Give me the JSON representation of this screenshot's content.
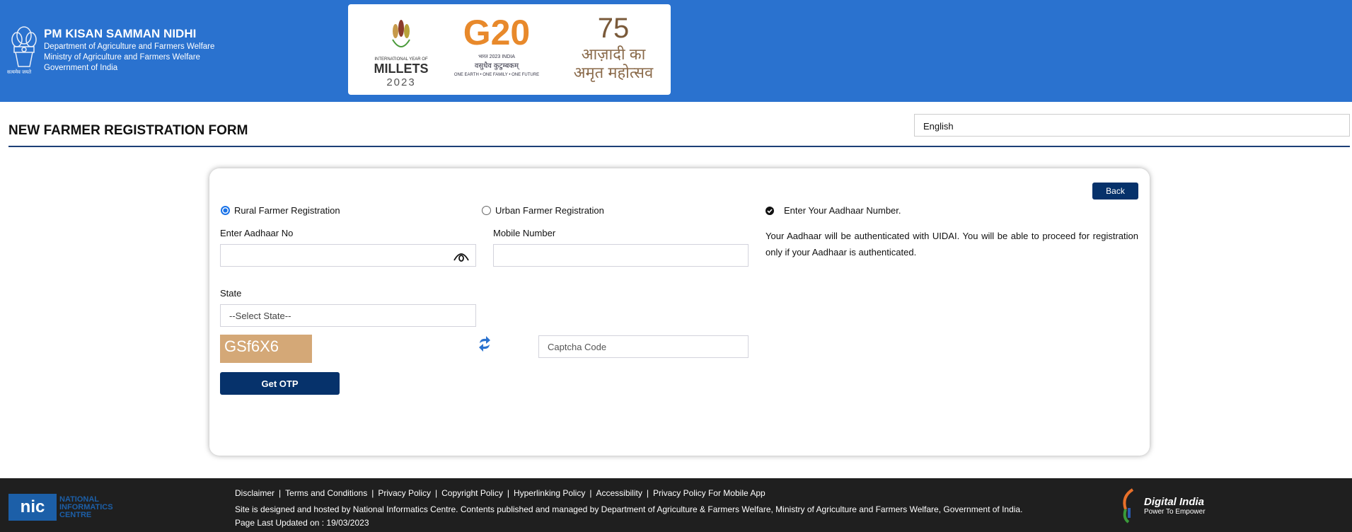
{
  "header": {
    "title": "PM KISAN SAMMAN NIDHI",
    "lines": [
      "Department of Agriculture and Farmers Welfare",
      "Ministry of Agriculture and Farmers Welfare",
      "Government of India"
    ],
    "emblem_caption": "सत्यमेव जयते",
    "logos": {
      "millets": {
        "top": "INTERNATIONAL YEAR OF",
        "name": "MILLETS",
        "year": "2023"
      },
      "g20": {
        "name": "G20",
        "sub": "भारत 2023 INDIA",
        "hindi": "वसुधैव कुटुम्बकम्",
        "tagline": "ONE EARTH • ONE FAMILY • ONE FUTURE"
      },
      "azadi": {
        "num": "75",
        "line1": "आज़ादी का",
        "line2": "अमृत महोत्सव"
      }
    }
  },
  "page": {
    "title": "NEW FARMER REGISTRATION FORM",
    "language": "English"
  },
  "form": {
    "back": "Back",
    "rural": "Rural Farmer Registration",
    "urban": "Urban Farmer Registration",
    "selected": "rural",
    "aadhaar_label": "Enter Aadhaar No",
    "aadhaar_value": "",
    "mobile_label": "Mobile Number",
    "mobile_value": "",
    "state_label": "State",
    "state_value": "--Select State--",
    "captcha_text": "GSf6X6",
    "captcha_placeholder": "Captcha Code",
    "submit": "Get OTP"
  },
  "info": {
    "step": "Enter Your Aadhaar Number.",
    "text": "Your Aadhaar will be authenticated with UIDAI. You will be able to proceed for registration only if your Aadhaar is authenticated."
  },
  "footer": {
    "links": [
      "Disclaimer",
      "Terms and Conditions",
      "Privacy Policy",
      "Copyright Policy",
      "Hyperlinking Policy",
      "Accessibility",
      "Privacy Policy For Mobile App"
    ],
    "hosted": "Site is designed and hosted by National Informatics Centre. Contents published and managed by Department of Agriculture & Farmers Welfare, Ministry of Agriculture and Farmers Welfare, Government of India.",
    "updated": "Page Last Updated on : 19/03/2023",
    "nic": [
      "NATIONAL",
      "INFORMATICS",
      "CENTRE"
    ],
    "digital_india": {
      "name": "Digital India",
      "tagline": "Power To Empower"
    }
  },
  "colors": {
    "header": "#2a72cf",
    "button": "#06326b",
    "footer": "#1f1f1f"
  }
}
